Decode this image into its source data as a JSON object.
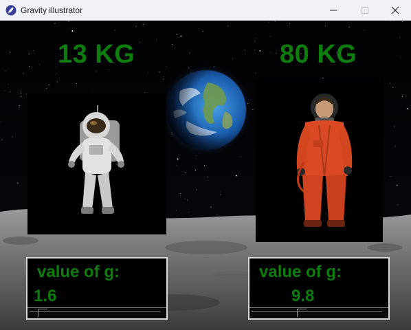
{
  "window": {
    "title": "Gravity illustrator",
    "icon": "feather-app-icon",
    "controls": [
      "minimize",
      "maximize",
      "close"
    ]
  },
  "left": {
    "mass_label": "13 KG",
    "g_heading": "value of g:",
    "g_value": "1.6",
    "slider_level": 0.06,
    "astronaut": "astronaut-white-suit"
  },
  "right": {
    "mass_label": "80 KG",
    "g_heading": "value of g:",
    "g_value": "9.8",
    "slider_level": 0.36,
    "astronaut": "astronaut-orange-suit"
  },
  "colors": {
    "label_green": "#0d7d0d",
    "titlebar": "#f0f2f8",
    "box_border": "#d8d8d8"
  }
}
